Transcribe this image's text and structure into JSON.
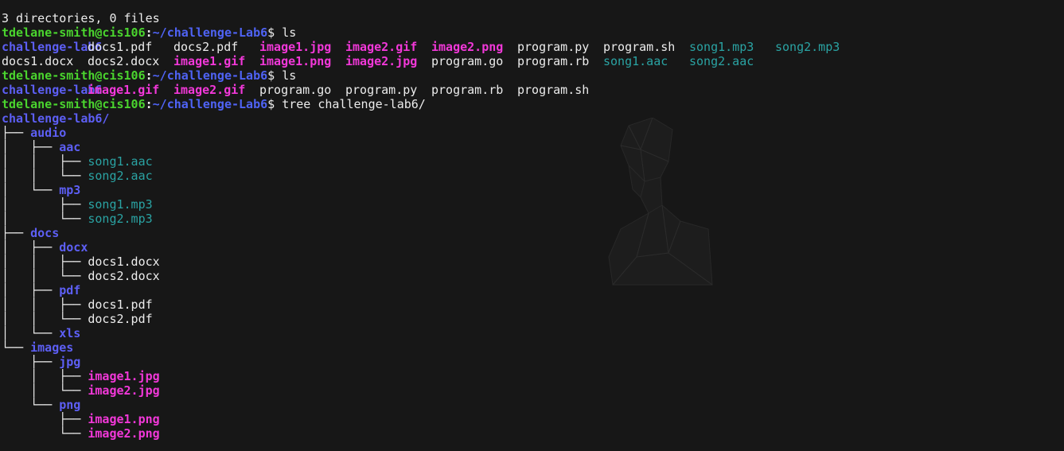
{
  "summary": "3 directories, 0 files",
  "prompt": {
    "user": "tdelane-smith@cis106",
    "sep": ":",
    "dir": "~/challenge-Lab6",
    "sym": "$"
  },
  "commands": [
    "ls",
    "ls",
    "tree challenge-lab6/"
  ],
  "ls1": {
    "row1": [
      {
        "t": "challenge-lab6",
        "k": "dir"
      },
      {
        "t": "docs1.pdf",
        "k": "plain"
      },
      {
        "t": "docs2.pdf",
        "k": "plain"
      },
      {
        "t": "image1.jpg",
        "k": "mag"
      },
      {
        "t": "image2.gif",
        "k": "mag"
      },
      {
        "t": "image2.png",
        "k": "mag"
      },
      {
        "t": "program.py",
        "k": "plain"
      },
      {
        "t": "program.sh",
        "k": "plain"
      },
      {
        "t": "song1.mp3",
        "k": "cyan"
      },
      {
        "t": "song2.mp3",
        "k": "cyan"
      }
    ],
    "row2": [
      {
        "t": "docs1.docx",
        "k": "plain"
      },
      {
        "t": "docs2.docx",
        "k": "plain"
      },
      {
        "t": "image1.gif",
        "k": "mag"
      },
      {
        "t": "image1.png",
        "k": "mag"
      },
      {
        "t": "image2.jpg",
        "k": "mag"
      },
      {
        "t": "program.go",
        "k": "plain"
      },
      {
        "t": "program.rb",
        "k": "plain"
      },
      {
        "t": "song1.aac",
        "k": "cyan"
      },
      {
        "t": "song2.aac",
        "k": "cyan"
      }
    ]
  },
  "ls2": [
    {
      "t": "challenge-lab6",
      "k": "dir"
    },
    {
      "t": "image1.gif",
      "k": "mag"
    },
    {
      "t": "image2.gif",
      "k": "mag"
    },
    {
      "t": "program.go",
      "k": "plain"
    },
    {
      "t": "program.py",
      "k": "plain"
    },
    {
      "t": "program.rb",
      "k": "plain"
    },
    {
      "t": "program.sh",
      "k": "plain"
    }
  ],
  "tree_root": "challenge-lab6/",
  "tree": [
    {
      "p": "├── ",
      "t": "audio",
      "k": "dir"
    },
    {
      "p": "│   ├── ",
      "t": "aac",
      "k": "dir"
    },
    {
      "p": "│   │   ├── ",
      "t": "song1.aac",
      "k": "cyan"
    },
    {
      "p": "│   │   └── ",
      "t": "song2.aac",
      "k": "cyan"
    },
    {
      "p": "│   └── ",
      "t": "mp3",
      "k": "dir"
    },
    {
      "p": "│       ├── ",
      "t": "song1.mp3",
      "k": "cyan"
    },
    {
      "p": "│       └── ",
      "t": "song2.mp3",
      "k": "cyan"
    },
    {
      "p": "├── ",
      "t": "docs",
      "k": "dir"
    },
    {
      "p": "│   ├── ",
      "t": "docx",
      "k": "dir"
    },
    {
      "p": "│   │   ├── ",
      "t": "docs1.docx",
      "k": "plain"
    },
    {
      "p": "│   │   └── ",
      "t": "docs2.docx",
      "k": "plain"
    },
    {
      "p": "│   ├── ",
      "t": "pdf",
      "k": "dir"
    },
    {
      "p": "│   │   ├── ",
      "t": "docs1.pdf",
      "k": "plain"
    },
    {
      "p": "│   │   └── ",
      "t": "docs2.pdf",
      "k": "plain"
    },
    {
      "p": "│   └── ",
      "t": "xls",
      "k": "dir"
    },
    {
      "p": "└── ",
      "t": "images",
      "k": "dir"
    },
    {
      "p": "    ├── ",
      "t": "jpg",
      "k": "dir"
    },
    {
      "p": "    │   ├── ",
      "t": "image1.jpg",
      "k": "mag"
    },
    {
      "p": "    │   └── ",
      "t": "image2.jpg",
      "k": "mag"
    },
    {
      "p": "    └── ",
      "t": "png",
      "k": "dir"
    },
    {
      "p": "        ├── ",
      "t": "image1.png",
      "k": "mag"
    },
    {
      "p": "        └── ",
      "t": "image2.png",
      "k": "mag"
    }
  ],
  "colors": {
    "background": "#171717",
    "user": "#4ad42e",
    "path": "#4f63f5",
    "dir": "#5d5ff5",
    "image": "#f238d9",
    "audio": "#2aa3a3",
    "text": "#ececec"
  },
  "icons": {
    "background_logo": "polygon-head-silhouette"
  }
}
